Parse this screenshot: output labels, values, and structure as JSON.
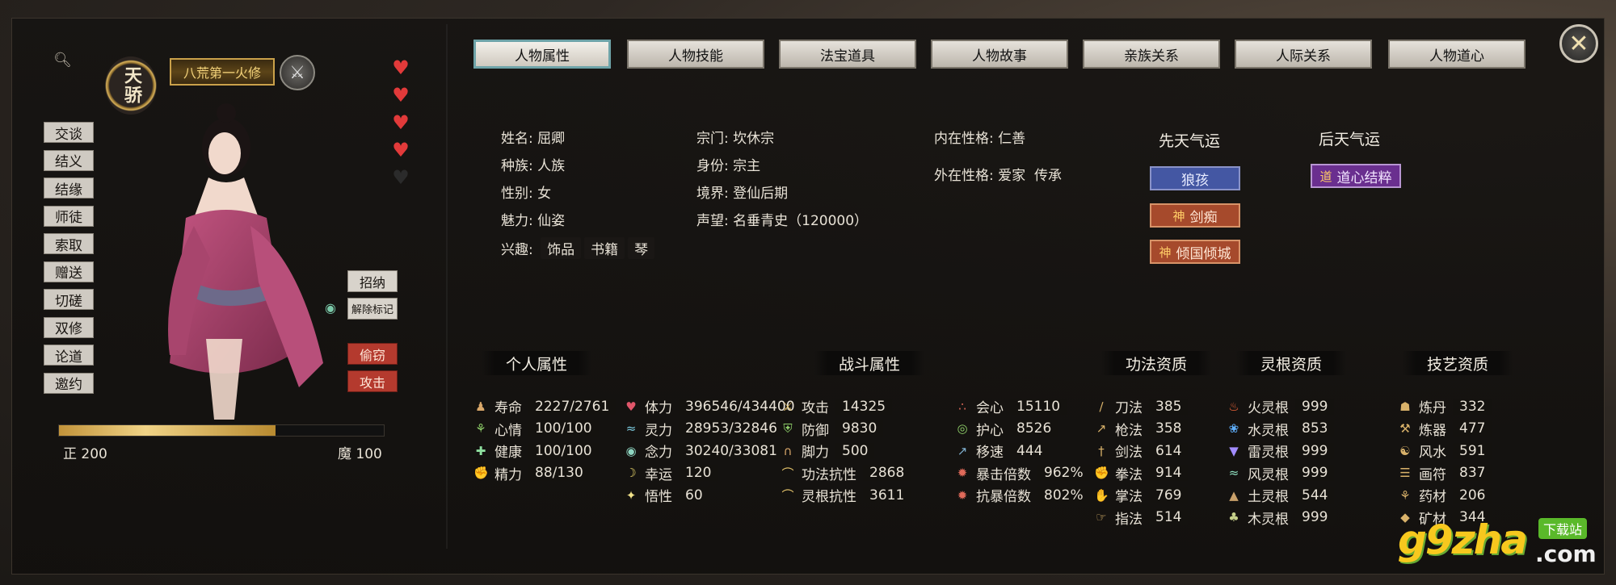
{
  "title_badge": "天骄",
  "title_plate": "八荒第一火修",
  "side_actions": [
    "交谈",
    "结义",
    "结缘",
    "师徒",
    "索取",
    "赠送",
    "切磋",
    "双修",
    "论道",
    "邀约"
  ],
  "hearts_count": 5,
  "hearts_filled": 4,
  "right_actions": {
    "recruit": "招纳",
    "unmark": "解除标记",
    "steal": "偷窃",
    "attack": "攻击"
  },
  "alignment": {
    "left_label": "正 200",
    "right_label": "魔 100",
    "fill_fraction": 0.667
  },
  "tabs": [
    "人物属性",
    "人物技能",
    "法宝道具",
    "人物故事",
    "亲族关系",
    "人际关系",
    "人物道心"
  ],
  "active_tab": 0,
  "info": {
    "name_label": "姓名:",
    "name": "屈卿",
    "race_label": "种族:",
    "race": "人族",
    "gender_label": "性别:",
    "gender": "女",
    "charm_label": "魅力:",
    "charm": "仙姿",
    "hobby_label": "兴趣:",
    "hobbies": [
      "饰品",
      "书籍",
      "琴"
    ],
    "sect_label": "宗门:",
    "sect": "坎休宗",
    "identity_label": "身份:",
    "identity": "宗主",
    "realm_label": "境界:",
    "realm": "登仙后期",
    "fame_label": "声望:",
    "fame": "名垂青史（120000）",
    "inner_label": "内在性格:",
    "inner": "仁善",
    "outer_label": "外在性格:",
    "outer": [
      "爱家",
      "传承"
    ]
  },
  "innate_qi": {
    "title": "先天气运",
    "items": [
      "狼孩",
      "剑痴",
      "倾国倾城"
    ]
  },
  "acquired_qi": {
    "title": "后天气运",
    "items": [
      "道心结粹"
    ]
  },
  "sections": {
    "personal": "个人属性",
    "combat": "战斗属性",
    "skill_apt": "功法资质",
    "root_apt": "灵根资质",
    "craft_apt": "技艺资质"
  },
  "personal": [
    {
      "icon": "person-icon",
      "label": "寿命",
      "value": "2227/2761"
    },
    {
      "icon": "sprout-icon",
      "label": "心情",
      "value": "100/100"
    },
    {
      "icon": "cross-icon",
      "label": "健康",
      "value": "100/100"
    },
    {
      "icon": "arm-icon",
      "label": "精力",
      "value": "88/130"
    }
  ],
  "combat_a": [
    {
      "icon": "heart-icon",
      "label": "体力",
      "value": "396546/434400"
    },
    {
      "icon": "wave-icon",
      "label": "灵力",
      "value": "28953/32846"
    },
    {
      "icon": "eye-icon",
      "label": "念力",
      "value": "30240/33081"
    },
    {
      "icon": "moon-icon",
      "label": "幸运",
      "value": "120"
    },
    {
      "icon": "star-icon",
      "label": "悟性",
      "value": "60"
    }
  ],
  "combat_b": [
    {
      "icon": "swords-icon",
      "label": "攻击",
      "value": "14325"
    },
    {
      "icon": "shield-icon",
      "label": "防御",
      "value": "9830"
    },
    {
      "icon": "foot-icon",
      "label": "脚力",
      "value": "500"
    },
    {
      "icon": "arc-icon",
      "label": "功法抗性",
      "value": "2868"
    },
    {
      "icon": "arc-icon",
      "label": "灵根抗性",
      "value": "3611"
    }
  ],
  "combat_c": [
    {
      "icon": "tri-icon",
      "label": "会心",
      "value": "15110"
    },
    {
      "icon": "guard-icon",
      "label": "护心",
      "value": "8526"
    },
    {
      "icon": "boot-icon",
      "label": "移速",
      "value": "444"
    },
    {
      "icon": "burst-icon",
      "label": "暴击倍数",
      "value": "962%"
    },
    {
      "icon": "burst-icon",
      "label": "抗暴倍数",
      "value": "802%"
    }
  ],
  "skill_apt": [
    {
      "icon": "blade-icon",
      "label": "刀法",
      "value": "385"
    },
    {
      "icon": "spear-icon",
      "label": "枪法",
      "value": "358"
    },
    {
      "icon": "sword-icon",
      "label": "剑法",
      "value": "614"
    },
    {
      "icon": "fist-icon",
      "label": "拳法",
      "value": "914"
    },
    {
      "icon": "palm-icon",
      "label": "掌法",
      "value": "769"
    },
    {
      "icon": "finger-icon",
      "label": "指法",
      "value": "514"
    }
  ],
  "root_apt": [
    {
      "icon": "fire-icon",
      "label": "火灵根",
      "value": "999"
    },
    {
      "icon": "water-icon",
      "label": "水灵根",
      "value": "853"
    },
    {
      "icon": "thunder-icon",
      "label": "雷灵根",
      "value": "999"
    },
    {
      "icon": "wind-icon",
      "label": "风灵根",
      "value": "999"
    },
    {
      "icon": "earth-icon",
      "label": "土灵根",
      "value": "544"
    },
    {
      "icon": "wood-icon",
      "label": "木灵根",
      "value": "999"
    }
  ],
  "craft_apt": [
    {
      "icon": "cauldron-icon",
      "label": "炼丹",
      "value": "332"
    },
    {
      "icon": "hammer-icon",
      "label": "炼器",
      "value": "477"
    },
    {
      "icon": "yinyang-icon",
      "label": "风水",
      "value": "591"
    },
    {
      "icon": "talisman-icon",
      "label": "画符",
      "value": "837"
    },
    {
      "icon": "herb-icon",
      "label": "药材",
      "value": "206"
    },
    {
      "icon": "ore-icon",
      "label": "矿材",
      "value": "344"
    }
  ],
  "watermark": {
    "main": "g9zha",
    "badge": "下载站",
    "com": ".com"
  }
}
